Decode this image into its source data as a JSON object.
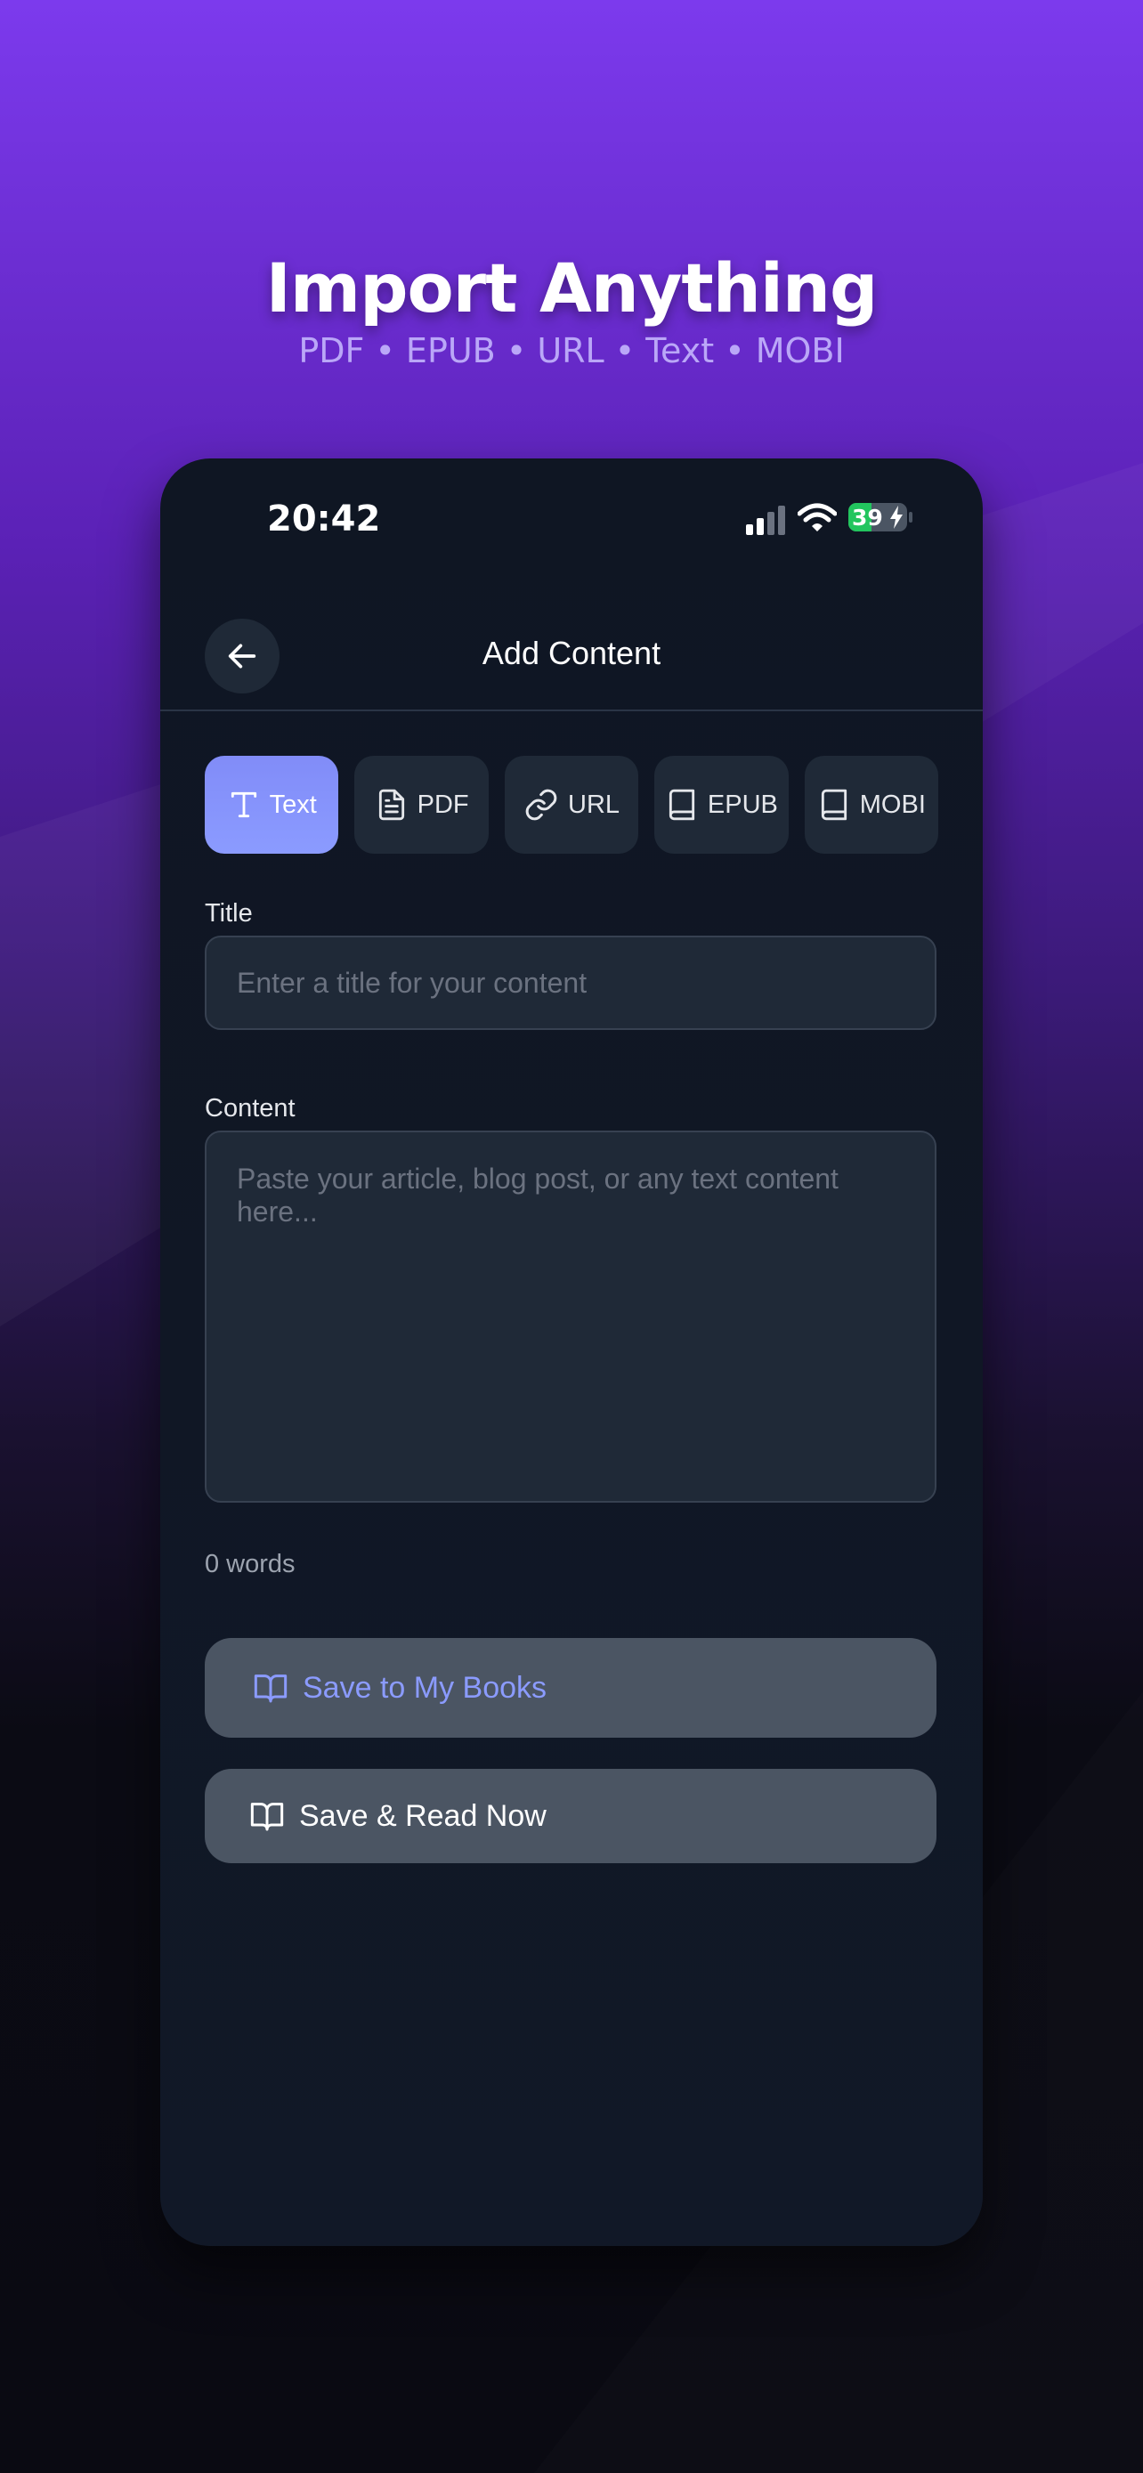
{
  "hero": {
    "title": "Import Anything",
    "subtitle": "PDF • EPUB • URL • Text • MOBI"
  },
  "status_bar": {
    "time": "20:42",
    "battery_level": "39",
    "battery_fraction": 0.39
  },
  "nav": {
    "title": "Add Content",
    "back_icon": "arrow-left-icon"
  },
  "tabs": [
    {
      "label": "Text",
      "icon": "text-type-icon",
      "active": true
    },
    {
      "label": "PDF",
      "icon": "file-document-icon",
      "active": false
    },
    {
      "label": "URL",
      "icon": "link-icon",
      "active": false
    },
    {
      "label": "EPUB",
      "icon": "book-icon",
      "active": false
    },
    {
      "label": "MOBI",
      "icon": "book-icon",
      "active": false
    }
  ],
  "form": {
    "title_label": "Title",
    "title_value": "",
    "title_placeholder": "Enter a title for your content",
    "content_label": "Content",
    "content_value": "",
    "content_placeholder": "Paste your article, blog post, or any text content here...",
    "word_count": "0 words"
  },
  "actions": {
    "save_label": "Save to My Books",
    "save_read_label": "Save & Read Now",
    "icon": "book-open-icon"
  },
  "colors": {
    "accent": "#818cf8",
    "accent_text": "#8b9bff",
    "background_top": "#7c3aed",
    "phone_bg": "#111827",
    "card_bg": "#1f2937",
    "battery_green": "#22c55e"
  }
}
